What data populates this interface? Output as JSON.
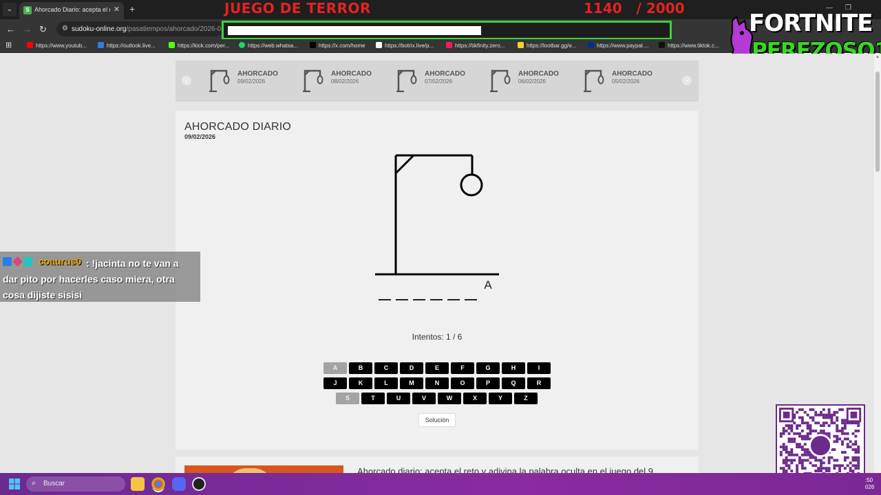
{
  "browser": {
    "tab_title": "Ahorcado Diario: acepta el reto",
    "tab_favicon": "S",
    "new_tab": "+",
    "url_host": "sudoku-online.org",
    "url_path": "/pasatiempos/ahorcado/2026-02-",
    "bookmarks": [
      {
        "label": "https://www.youtub...",
        "color": "#ff0000"
      },
      {
        "label": "https://outlook.live...",
        "color": "#2f7de1"
      },
      {
        "label": "https://kick.com/per...",
        "color": "#53fc18"
      },
      {
        "label": "https://web.whatsa...",
        "color": "#25d366"
      },
      {
        "label": "https://x.com/home",
        "color": "#000000"
      },
      {
        "label": "https://botrix.live/p...",
        "color": "#ffffff"
      },
      {
        "label": "https://tikfinity.zero...",
        "color": "#e91e63"
      },
      {
        "label": "https://lootbar.gg/e...",
        "color": "#f7d02c"
      },
      {
        "label": "https://www.paypal....",
        "color": "#003087"
      },
      {
        "label": "https://www.tiktok.c...",
        "color": "#111111"
      }
    ]
  },
  "stream": {
    "title": "JUEGO DE TERROR",
    "counter": "1140   / 2000",
    "logo_top": "FORTNITE",
    "logo_bottom": "PEREZOSO1"
  },
  "carousel": {
    "items": [
      {
        "title": "AHORCADO",
        "date": "09/02/2026"
      },
      {
        "title": "AHORCADO",
        "date": "08/02/2026"
      },
      {
        "title": "AHORCADO",
        "date": "07/02/2026"
      },
      {
        "title": "AHORCADO",
        "date": "06/02/2026"
      },
      {
        "title": "AHORCADO",
        "date": "05/02/2026"
      }
    ]
  },
  "game": {
    "title": "AHORCADO DIARIO",
    "date": "09/02/2026",
    "word_slots": [
      "",
      "",
      "",
      "",
      "",
      "",
      "A"
    ],
    "attempts_label": "Intentos: 1 / 6",
    "keyboard_rows": [
      [
        "A",
        "B",
        "C",
        "D",
        "E",
        "F",
        "G",
        "H",
        "I"
      ],
      [
        "J",
        "K",
        "L",
        "M",
        "N",
        "O",
        "P",
        "Q",
        "R"
      ],
      [
        "S",
        "T",
        "U",
        "V",
        "W",
        "X",
        "Y",
        "Z"
      ]
    ],
    "used_letters": [
      "A",
      "S"
    ],
    "solution_label": "Solución"
  },
  "article": {
    "heading": "Ahorcado diario: acepta el reto y adivina la palabra oculta en el juego del 9"
  },
  "chat": {
    "username": "coaurus0",
    "message": ": !jacinta no te van a dar pito por hacerles caso miera, otra cosa dijiste sisisi"
  },
  "taskbar": {
    "search_placeholder": "Buscar",
    "clock_time": ":50",
    "clock_date": "026"
  },
  "colors": {
    "accent_red": "#e52222",
    "highlight_green": "#3dd23d",
    "taskbar_purple": "#7a2894"
  }
}
